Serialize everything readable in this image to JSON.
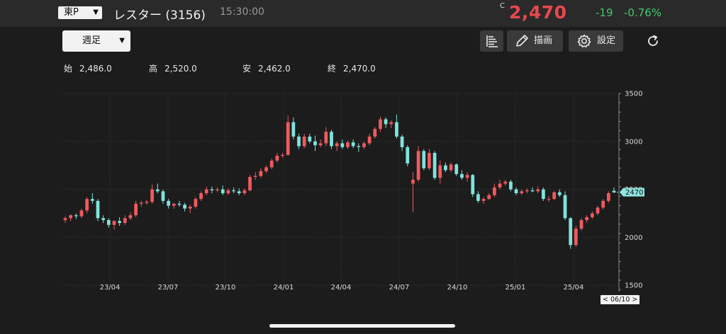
{
  "header": {
    "market": "東P",
    "stock_name": "レスター (3156)",
    "time": "15:30:00",
    "price_flag": "C",
    "price": "2,470",
    "change": "-19",
    "change_pct": "-0.76%"
  },
  "toolbar": {
    "period": "週足",
    "draw_label": "描画",
    "settings_label": "設定"
  },
  "ohlc": [
    {
      "key": "始",
      "value": "2,486.0"
    },
    {
      "key": "高",
      "value": "2,520.0"
    },
    {
      "key": "安",
      "value": "2,462.0"
    },
    {
      "key": "終",
      "value": "2,470.0"
    }
  ],
  "colors": {
    "up": "#ef5a5f",
    "down": "#7fe3dc",
    "price_red": "#e8484d",
    "change_green": "#43c86b",
    "price_tag": "#8ee5e0"
  },
  "chart_data": {
    "type": "candlestick",
    "x_tick_labels": [
      "23/04",
      "23/07",
      "23/10",
      "24/01",
      "24/04",
      "24/07",
      "24/10",
      "25/01",
      "25/04"
    ],
    "y_tick_labels": [
      "3500",
      "3000",
      "2500",
      "2000",
      "1500"
    ],
    "ylim": [
      1450,
      3500
    ],
    "grid": true,
    "last_price_label": "2470",
    "current_date_label": "< 06/10 >",
    "candles": [
      [
        2180,
        2220,
        2150,
        2200
      ],
      [
        2200,
        2240,
        2170,
        2230
      ],
      [
        2230,
        2250,
        2190,
        2220
      ],
      [
        2220,
        2300,
        2200,
        2280
      ],
      [
        2280,
        2420,
        2250,
        2400
      ],
      [
        2400,
        2460,
        2350,
        2380
      ],
      [
        2380,
        2400,
        2170,
        2200
      ],
      [
        2200,
        2230,
        2150,
        2180
      ],
      [
        2180,
        2200,
        2100,
        2130
      ],
      [
        2130,
        2180,
        2080,
        2170
      ],
      [
        2170,
        2210,
        2120,
        2150
      ],
      [
        2150,
        2230,
        2130,
        2200
      ],
      [
        2200,
        2260,
        2180,
        2230
      ],
      [
        2230,
        2380,
        2210,
        2350
      ],
      [
        2350,
        2380,
        2320,
        2360
      ],
      [
        2360,
        2390,
        2340,
        2370
      ],
      [
        2370,
        2550,
        2350,
        2500
      ],
      [
        2500,
        2560,
        2460,
        2480
      ],
      [
        2480,
        2500,
        2350,
        2380
      ],
      [
        2380,
        2400,
        2300,
        2330
      ],
      [
        2330,
        2360,
        2300,
        2350
      ],
      [
        2350,
        2380,
        2320,
        2340
      ],
      [
        2340,
        2360,
        2270,
        2300
      ],
      [
        2300,
        2340,
        2250,
        2320
      ],
      [
        2320,
        2420,
        2300,
        2400
      ],
      [
        2400,
        2480,
        2380,
        2460
      ],
      [
        2460,
        2530,
        2440,
        2500
      ],
      [
        2500,
        2530,
        2460,
        2490
      ],
      [
        2490,
        2520,
        2470,
        2500
      ],
      [
        2500,
        2540,
        2440,
        2460
      ],
      [
        2460,
        2510,
        2440,
        2490
      ],
      [
        2490,
        2520,
        2460,
        2480
      ],
      [
        2480,
        2510,
        2440,
        2460
      ],
      [
        2460,
        2510,
        2440,
        2490
      ],
      [
        2490,
        2650,
        2480,
        2630
      ],
      [
        2630,
        2680,
        2600,
        2640
      ],
      [
        2640,
        2720,
        2620,
        2690
      ],
      [
        2690,
        2750,
        2670,
        2730
      ],
      [
        2730,
        2820,
        2710,
        2800
      ],
      [
        2800,
        2880,
        2780,
        2850
      ],
      [
        2850,
        2880,
        2830,
        2860
      ],
      [
        2860,
        3270,
        2850,
        3200
      ],
      [
        3200,
        3250,
        3020,
        3050
      ],
      [
        3050,
        3080,
        2920,
        2950
      ],
      [
        2950,
        3080,
        2930,
        3050
      ],
      [
        3050,
        3080,
        2980,
        3000
      ],
      [
        3000,
        3060,
        2900,
        2960
      ],
      [
        2960,
        3020,
        2940,
        2980
      ],
      [
        2980,
        3150,
        2950,
        3100
      ],
      [
        3100,
        3120,
        2920,
        2950
      ],
      [
        2950,
        3000,
        2900,
        2980
      ],
      [
        2980,
        3020,
        2920,
        2940
      ],
      [
        2940,
        3010,
        2920,
        2990
      ],
      [
        2990,
        3020,
        2930,
        2950
      ],
      [
        2950,
        2980,
        2890,
        2940
      ],
      [
        2940,
        3000,
        2920,
        2980
      ],
      [
        2980,
        3080,
        2960,
        3050
      ],
      [
        3050,
        3150,
        3030,
        3130
      ],
      [
        3130,
        3260,
        3100,
        3230
      ],
      [
        3230,
        3250,
        3140,
        3180
      ],
      [
        3180,
        3220,
        3140,
        3200
      ],
      [
        3200,
        3280,
        3030,
        3050
      ],
      [
        3050,
        3070,
        2900,
        2940
      ],
      [
        2940,
        2960,
        2740,
        2770
      ],
      [
        2560,
        2680,
        2260,
        2600
      ],
      [
        2600,
        2950,
        2580,
        2900
      ],
      [
        2900,
        2920,
        2700,
        2720
      ],
      [
        2720,
        2920,
        2700,
        2880
      ],
      [
        2880,
        2900,
        2600,
        2620
      ],
      [
        2620,
        2800,
        2560,
        2750
      ],
      [
        2750,
        2780,
        2680,
        2700
      ],
      [
        2700,
        2780,
        2680,
        2760
      ],
      [
        2760,
        2770,
        2640,
        2660
      ],
      [
        2660,
        2700,
        2600,
        2620
      ],
      [
        2620,
        2680,
        2580,
        2650
      ],
      [
        2650,
        2660,
        2420,
        2450
      ],
      [
        2450,
        2480,
        2360,
        2380
      ],
      [
        2380,
        2420,
        2350,
        2400
      ],
      [
        2400,
        2460,
        2390,
        2440
      ],
      [
        2440,
        2560,
        2420,
        2520
      ],
      [
        2520,
        2600,
        2500,
        2560
      ],
      [
        2560,
        2600,
        2540,
        2580
      ],
      [
        2580,
        2600,
        2480,
        2500
      ],
      [
        2500,
        2520,
        2440,
        2460
      ],
      [
        2460,
        2500,
        2440,
        2480
      ],
      [
        2480,
        2510,
        2460,
        2490
      ],
      [
        2490,
        2520,
        2470,
        2480
      ],
      [
        2480,
        2530,
        2460,
        2500
      ],
      [
        2500,
        2520,
        2380,
        2400
      ],
      [
        2400,
        2430,
        2370,
        2400
      ],
      [
        2400,
        2480,
        2390,
        2470
      ],
      [
        2470,
        2500,
        2420,
        2440
      ],
      [
        2440,
        2480,
        2180,
        2200
      ],
      [
        2200,
        2210,
        1880,
        1920
      ],
      [
        1920,
        2120,
        1900,
        2090
      ],
      [
        2090,
        2200,
        2070,
        2180
      ],
      [
        2180,
        2230,
        2150,
        2210
      ],
      [
        2210,
        2270,
        2190,
        2250
      ],
      [
        2250,
        2330,
        2230,
        2310
      ],
      [
        2310,
        2400,
        2290,
        2380
      ],
      [
        2380,
        2480,
        2360,
        2460
      ],
      [
        2486,
        2520,
        2462,
        2470
      ]
    ]
  }
}
